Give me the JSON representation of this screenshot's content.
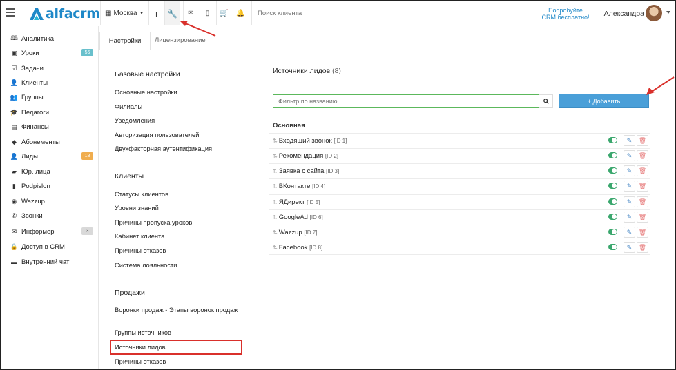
{
  "app": {
    "logo_text": "alfacrm"
  },
  "header": {
    "city": "Москва",
    "search_placeholder": "Поиск клиента",
    "try_text_1": "Попробуйте",
    "try_text_2": "CRM бесплатно!",
    "user_name": "Александра"
  },
  "sidebar": {
    "items": [
      {
        "label": "Аналитика",
        "icon": "analytics-icon"
      },
      {
        "label": "Уроки",
        "icon": "calendar-icon",
        "badge": "56"
      },
      {
        "label": "Задачи",
        "icon": "tasks-icon"
      },
      {
        "label": "Клиенты",
        "icon": "client-icon"
      },
      {
        "label": "Группы",
        "icon": "group-icon"
      },
      {
        "label": "Педагоги",
        "icon": "graduation-cap-icon"
      },
      {
        "label": "Финансы",
        "icon": "finance-icon"
      },
      {
        "label": "Абонементы",
        "icon": "tag-icon"
      },
      {
        "label": "Лиды",
        "icon": "lead-icon",
        "badge": "18"
      },
      {
        "label": "Юр. лица",
        "icon": "briefcase-icon"
      },
      {
        "label": "Podpislon",
        "icon": "document-icon"
      },
      {
        "label": "Wazzup",
        "icon": "whatsapp-icon"
      },
      {
        "label": "Звонки",
        "icon": "phone-icon"
      },
      {
        "label": "Информер",
        "icon": "envelope-icon",
        "badge": "3"
      },
      {
        "label": "Доступ в CRM",
        "icon": "lock-icon"
      },
      {
        "label": "Внутренний чат",
        "icon": "chat-icon"
      }
    ]
  },
  "tabs": {
    "settings": "Настройки",
    "licensing": "Лицензирование"
  },
  "menu": {
    "basic_title": "Базовые настройки",
    "basic_items": [
      "Основные настройки",
      "Филиалы",
      "Уведомления",
      "Авторизация пользователей",
      "Двухфакторная аутентификация"
    ],
    "clients_title": "Клиенты",
    "clients_items": [
      "Статусы клиентов",
      "Уровни знаний",
      "Причины пропуска уроков",
      "Кабинет клиента",
      "Причины отказов",
      "Система лояльности"
    ],
    "sales_title": "Продажи",
    "sales_items": [
      "Воронки продаж - Этапы воронок продаж",
      "Группы источников",
      "Источники лидов",
      "Причины отказов"
    ]
  },
  "main": {
    "title": "Источники лидов",
    "count": "(8)",
    "filter_placeholder": "Фильтр по названию",
    "add_button": "+ Добавить",
    "group": "Основная",
    "rows": [
      {
        "name": "Входящий звонок",
        "id": "[ID 1]"
      },
      {
        "name": "Рекомендация",
        "id": "[ID 2]"
      },
      {
        "name": "Заявка с сайта",
        "id": "[ID 3]"
      },
      {
        "name": "ВКонтакте",
        "id": "[ID 4]"
      },
      {
        "name": "ЯДирект",
        "id": "[ID 5]"
      },
      {
        "name": "GoogleAd",
        "id": "[ID 6]"
      },
      {
        "name": "Wazzup",
        "id": "[ID 7]"
      },
      {
        "name": "Facebook",
        "id": "[ID 8]"
      }
    ]
  },
  "colors": {
    "accent": "#1e88c8",
    "toggle_on": "#3aa76d",
    "annotation": "#d9302b",
    "add_button": "#4a9fd8"
  }
}
